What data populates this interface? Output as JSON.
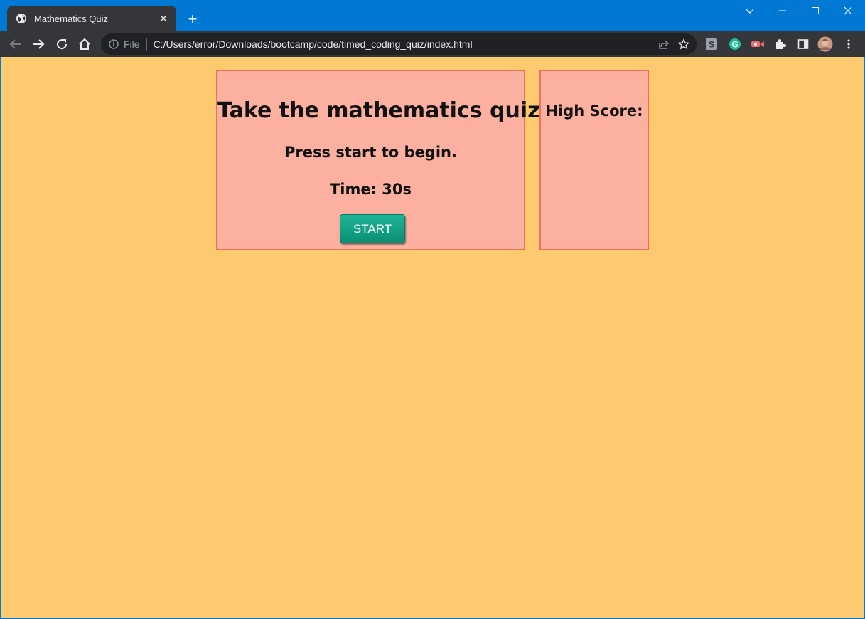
{
  "browser": {
    "tab_title": "Mathematics Quiz",
    "new_tab_symbol": "+",
    "close_symbol": "✕",
    "file_label": "File",
    "url": "C:/Users/error/Downloads/bootcamp/code/timed_coding_quiz/index.html",
    "frame_color": "#0078d4"
  },
  "quiz": {
    "heading": "Take the mathematics quiz!",
    "prompt": "Press start to begin.",
    "timer": "Time: 30s",
    "start_label": "START"
  },
  "scoreboard": {
    "heading": "High Score:"
  },
  "colors": {
    "page_background": "#fdca70",
    "box_background": "#fbb0a0",
    "box_border": "#f0705a",
    "button": "#14a383"
  }
}
